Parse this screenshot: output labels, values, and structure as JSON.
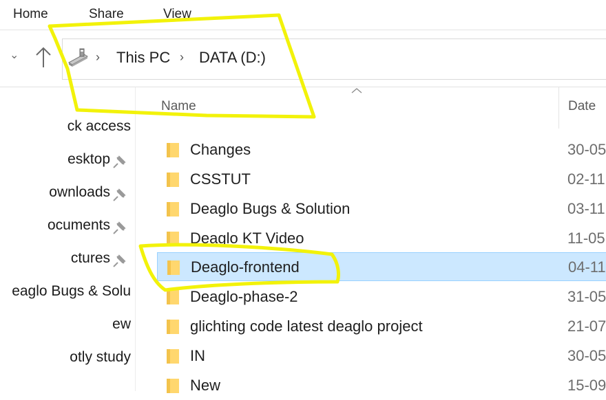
{
  "ribbon": {
    "tabs": [
      "Home",
      "Share",
      "View"
    ]
  },
  "address": {
    "icon": "usb-drive-icon",
    "crumbs": [
      "This PC",
      "DATA (D:)"
    ]
  },
  "navpane": {
    "items": [
      {
        "label": "ck access",
        "pinned": false
      },
      {
        "label": "esktop",
        "pinned": true
      },
      {
        "label": "ownloads",
        "pinned": true
      },
      {
        "label": "ocuments",
        "pinned": true
      },
      {
        "label": "ctures",
        "pinned": true
      },
      {
        "label": "eaglo Bugs & Solu",
        "pinned": false
      },
      {
        "label": "ew",
        "pinned": false
      },
      {
        "label": "otly study",
        "pinned": false
      }
    ]
  },
  "columns": {
    "name": "Name",
    "date": "Date"
  },
  "files": [
    {
      "name": "Changes",
      "date": "30-05",
      "selected": false
    },
    {
      "name": "CSSTUT",
      "date": "02-11",
      "selected": false
    },
    {
      "name": "Deaglo Bugs & Solution",
      "date": "03-11",
      "selected": false
    },
    {
      "name": "Deaglo KT Video",
      "date": "11-05",
      "selected": false
    },
    {
      "name": "Deaglo-frontend",
      "date": "04-11",
      "selected": true
    },
    {
      "name": "Deaglo-phase-2",
      "date": "31-05",
      "selected": false
    },
    {
      "name": "glichting code latest deaglo project",
      "date": "21-07",
      "selected": false
    },
    {
      "name": "IN",
      "date": "30-05",
      "selected": false
    },
    {
      "name": "New",
      "date": "15-09",
      "selected": false
    }
  ],
  "colors": {
    "selection": "#cce8ff",
    "selection_border": "#99d1ff",
    "folder": "#f3c34c",
    "highlighter": "#f2f20a"
  }
}
